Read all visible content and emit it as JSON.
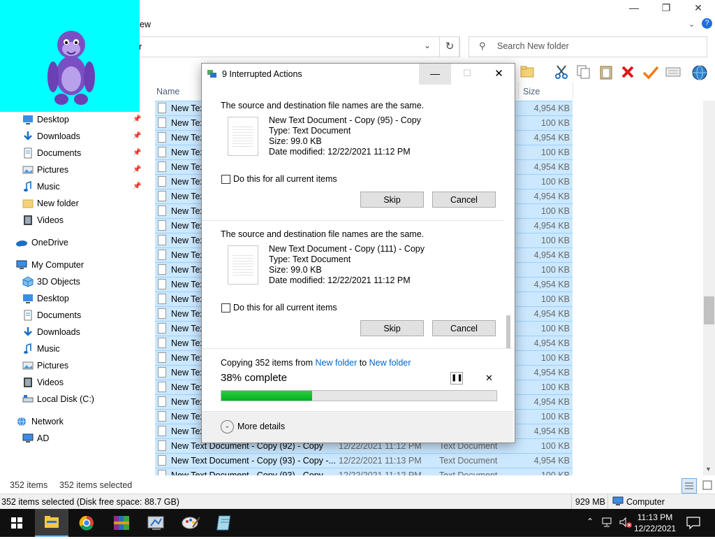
{
  "explorer": {
    "menu_partial": "ew",
    "address_partial": "r",
    "search_placeholder": "Search New folder",
    "col_name": "Name",
    "col_size": "Size",
    "status_left_count": "352 items",
    "status_left_selected": "352 items selected",
    "status_bottom": "352 items selected (Disk free space: 88.7 GB)",
    "status_size": "929 MB",
    "status_location": "Computer"
  },
  "nav": {
    "quick": [
      {
        "label": "Desktop",
        "icon": "desktop-icon",
        "pinned": true
      },
      {
        "label": "Downloads",
        "icon": "download-arrow-icon",
        "pinned": true
      },
      {
        "label": "Documents",
        "icon": "documents-icon",
        "pinned": true
      },
      {
        "label": "Pictures",
        "icon": "pictures-icon",
        "pinned": true
      },
      {
        "label": "Music",
        "icon": "music-note-icon",
        "pinned": true
      },
      {
        "label": "New folder",
        "icon": "folder-icon",
        "pinned": false
      },
      {
        "label": "Videos",
        "icon": "film-icon",
        "pinned": false
      }
    ],
    "onedrive": "OneDrive",
    "computer": "My Computer",
    "computer_items": [
      {
        "label": "3D Objects",
        "icon": "cube-icon"
      },
      {
        "label": "Desktop",
        "icon": "desktop-icon"
      },
      {
        "label": "Documents",
        "icon": "documents-icon"
      },
      {
        "label": "Downloads",
        "icon": "download-arrow-icon"
      },
      {
        "label": "Music",
        "icon": "music-note-icon"
      },
      {
        "label": "Pictures",
        "icon": "pictures-icon"
      },
      {
        "label": "Videos",
        "icon": "film-icon"
      },
      {
        "label": "Local Disk (C:)",
        "icon": "drive-icon"
      }
    ],
    "network": "Network",
    "network_items": [
      {
        "label": "AD",
        "icon": "computer-icon"
      }
    ]
  },
  "files": [
    {
      "name": "New Tex",
      "size": "4,954 KB"
    },
    {
      "name": "New Tex",
      "size": "100 KB"
    },
    {
      "name": "New Tex",
      "size": "4,954 KB"
    },
    {
      "name": "New Tex",
      "size": "100 KB"
    },
    {
      "name": "New Tex",
      "size": "4,954 KB"
    },
    {
      "name": "New Tex",
      "size": "100 KB"
    },
    {
      "name": "New Tex",
      "size": "4,954 KB"
    },
    {
      "name": "New Tex",
      "size": "100 KB"
    },
    {
      "name": "New Tex",
      "size": "4,954 KB"
    },
    {
      "name": "New Tex",
      "size": "100 KB"
    },
    {
      "name": "New Tex",
      "size": "4,954 KB"
    },
    {
      "name": "New Tex",
      "size": "100 KB"
    },
    {
      "name": "New Tex",
      "size": "4,954 KB"
    },
    {
      "name": "New Tex",
      "size": "100 KB"
    },
    {
      "name": "New Tex",
      "size": "4,954 KB"
    },
    {
      "name": "New Tex",
      "size": "100 KB"
    },
    {
      "name": "New Tex",
      "size": "4,954 KB"
    },
    {
      "name": "New Tex",
      "size": "100 KB"
    },
    {
      "name": "New Tex",
      "size": "4,954 KB"
    },
    {
      "name": "New Tex",
      "size": "100 KB"
    },
    {
      "name": "New Tex",
      "size": "4,954 KB"
    },
    {
      "name": "New Tex",
      "size": "100 KB"
    },
    {
      "name": "New Tex",
      "size": "4,954 KB"
    },
    {
      "name": "New Text Document - Copy (92) - Copy",
      "date": "12/22/2021 11:12 PM",
      "type": "Text Document",
      "size": "100 KB"
    },
    {
      "name": "New Text Document - Copy (93) - Copy -...",
      "date": "12/22/2021 11:13 PM",
      "type": "Text Document",
      "size": "4,954 KB"
    },
    {
      "name": "New Text Document - Copy (93) - Copy",
      "date": "12/22/2021 11:12 PM",
      "type": "Text Document",
      "size": "100 KB"
    }
  ],
  "dialog": {
    "title": "9 Interrupted Actions",
    "conflicts": [
      {
        "message": "The source and destination file names are the same.",
        "file_name": "New Text Document - Copy (95) - Copy",
        "type": "Type: Text Document",
        "size": "Size: 99.0 KB",
        "modified": "Date modified: 12/22/2021 11:12 PM",
        "checkbox": "Do this for all current items",
        "skip": "Skip",
        "cancel": "Cancel"
      },
      {
        "message": "The source and destination file names are the same.",
        "file_name": "New Text Document - Copy (111) - Copy",
        "type": "Type: Text Document",
        "size": "Size: 99.0 KB",
        "modified": "Date modified: 12/22/2021 11:12 PM",
        "checkbox": "Do this for all current items",
        "skip": "Skip",
        "cancel": "Cancel"
      }
    ],
    "copy_prefix": "Copying 352 items from",
    "copy_from": "New folder",
    "copy_to_word": "to",
    "copy_to": "New folder",
    "percent_text": "38% complete",
    "progress": 0.38,
    "more_details": "More details"
  },
  "taskbar": {
    "time": "11:13 PM",
    "date": "12/22/2021"
  },
  "colors": {
    "cyan_overlay": "#00ffff",
    "selection": "#cce8ff",
    "progress_green": "#06b025",
    "link": "#0066cc",
    "taskbar": "#101010"
  }
}
